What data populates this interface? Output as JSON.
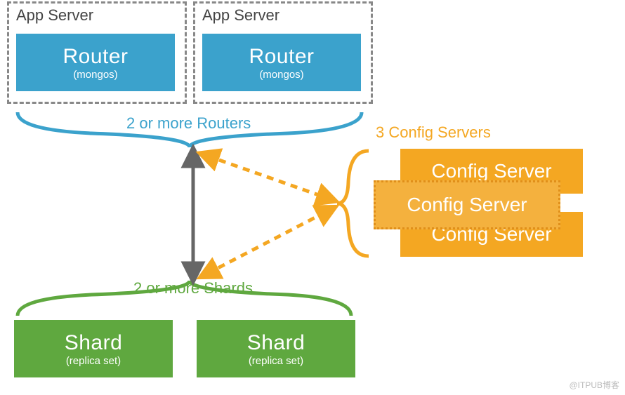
{
  "appServers": {
    "label": "App Server",
    "items": [
      {
        "title": "Router",
        "subtitle": "(mongos)"
      },
      {
        "title": "Router",
        "subtitle": "(mongos)"
      }
    ]
  },
  "routersLabel": "2 or more Routers",
  "shardsLabel": "2 or more Shards",
  "configLabel": "3 Config Servers",
  "shards": [
    {
      "title": "Shard",
      "subtitle": "(replica set)"
    },
    {
      "title": "Shard",
      "subtitle": "(replica set)"
    }
  ],
  "configServers": [
    {
      "title": "Config Server"
    },
    {
      "title": "Config Server"
    },
    {
      "title": "Config Server"
    }
  ],
  "watermark": "@ITPUB博客"
}
